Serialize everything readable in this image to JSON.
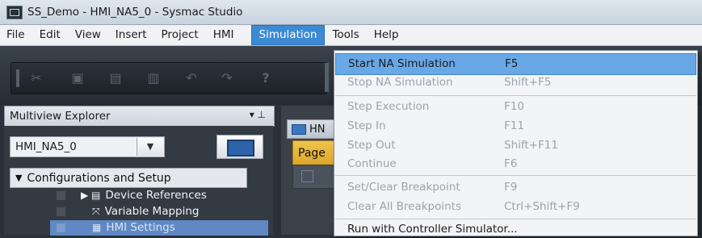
{
  "window": {
    "title": "SS_Demo - HMI_NA5_0 - Sysmac Studio"
  },
  "menubar": {
    "items": [
      {
        "label": "File"
      },
      {
        "label": "Edit"
      },
      {
        "label": "View"
      },
      {
        "label": "Insert"
      },
      {
        "label": "Project"
      },
      {
        "label": "HMI"
      },
      {
        "label": "Simulation"
      },
      {
        "label": "Tools"
      },
      {
        "label": "Help"
      }
    ]
  },
  "toolbar": {
    "icons": [
      "cut-icon",
      "copy-icon",
      "paste-icon",
      "delete-icon",
      "undo-icon",
      "redo-icon",
      "help-icon"
    ]
  },
  "explorer": {
    "title": "Multiview Explorer",
    "controls": "▾ ⊥",
    "device_selector": {
      "value": "HMI_NA5_0"
    },
    "section": {
      "label": "Configurations and Setup"
    },
    "tree": [
      {
        "label": "Device References",
        "glyph": "▶ ▤"
      },
      {
        "label": "Variable Mapping",
        "glyph": "⤧"
      },
      {
        "label": "HMI Settings",
        "glyph": "▦"
      }
    ]
  },
  "workspace": {
    "doc_tab": "HN",
    "page_tab": "Page"
  },
  "simulation_menu": {
    "items": [
      {
        "label": "Start NA Simulation",
        "shortcut": "F5",
        "enabled": true,
        "highlighted": true
      },
      {
        "label": "Stop NA Simulation",
        "shortcut": "Shift+F5",
        "enabled": false
      },
      {
        "label": "Step Execution",
        "shortcut": "F10",
        "enabled": false
      },
      {
        "label": "Step In",
        "shortcut": "F11",
        "enabled": false
      },
      {
        "label": "Step Out",
        "shortcut": "Shift+F11",
        "enabled": false
      },
      {
        "label": "Continue",
        "shortcut": "F6",
        "enabled": false
      },
      {
        "label": "Set/Clear Breakpoint",
        "shortcut": "F9",
        "enabled": false
      },
      {
        "label": "Clear All Breakpoints",
        "shortcut": "Ctrl+Shift+F9",
        "enabled": false
      },
      {
        "label": "Run with Controller Simulator...",
        "shortcut": "",
        "enabled": true
      }
    ]
  }
}
